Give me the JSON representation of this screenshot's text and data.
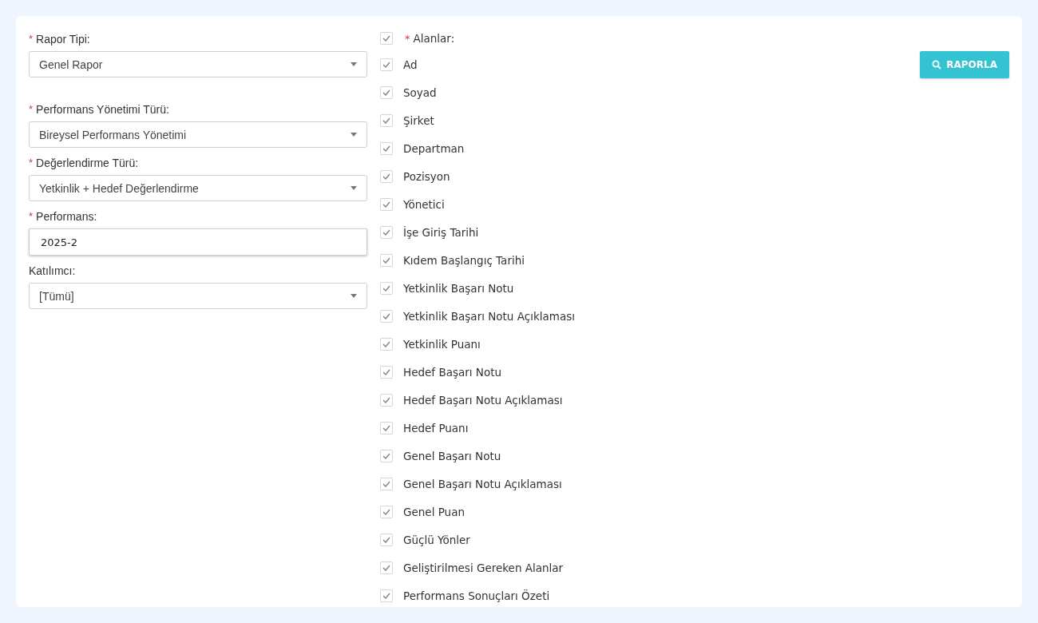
{
  "form": {
    "fields": [
      {
        "kind": "select",
        "label": "Rapor Tipi:",
        "required_marker": "*",
        "value": "Genel Rapor"
      },
      {
        "kind": "select",
        "label": "Performans Yönetimi Türü:",
        "required_marker": "*",
        "value": "Bireysel Performans Yönetimi"
      },
      {
        "kind": "select",
        "label": "Değerlendirme Türü:",
        "required_marker": "*",
        "value": "Yetkinlik + Hedef Değerlendirme"
      },
      {
        "kind": "input",
        "label": "Performans:",
        "required_marker": "*",
        "value": "2025-2"
      },
      {
        "kind": "select",
        "label": "Katılımcı:",
        "value": "[Tümü]"
      }
    ]
  },
  "fields_list": {
    "label": "Alanlar:",
    "required_marker": "*",
    "checked": true,
    "items": [
      {
        "label": "Ad",
        "checked": true
      },
      {
        "label": "Soyad",
        "checked": true
      },
      {
        "label": "Şirket",
        "checked": true
      },
      {
        "label": "Departman",
        "checked": true
      },
      {
        "label": "Pozisyon",
        "checked": true
      },
      {
        "label": "Yönetici",
        "checked": true
      },
      {
        "label": "İşe Giriş Tarihi",
        "checked": true
      },
      {
        "label": "Kıdem Başlangıç Tarihi",
        "checked": true
      },
      {
        "label": "Yetkinlik Başarı Notu",
        "checked": true
      },
      {
        "label": "Yetkinlik Başarı Notu Açıklaması",
        "checked": true
      },
      {
        "label": "Yetkinlik Puanı",
        "checked": true
      },
      {
        "label": "Hedef Başarı Notu",
        "checked": true
      },
      {
        "label": "Hedef Başarı Notu Açıklaması",
        "checked": true
      },
      {
        "label": "Hedef Puanı",
        "checked": true
      },
      {
        "label": "Genel Başarı Notu",
        "checked": true
      },
      {
        "label": "Genel Başarı Notu Açıklaması",
        "checked": true
      },
      {
        "label": "Genel Puan",
        "checked": true
      },
      {
        "label": "Güçlü Yönler",
        "checked": true
      },
      {
        "label": "Geliştirilmesi Gereken Alanlar",
        "checked": true
      },
      {
        "label": "Performans Sonuçları Özeti",
        "checked": true
      }
    ]
  },
  "report_button": {
    "label": "RAPORLA"
  }
}
